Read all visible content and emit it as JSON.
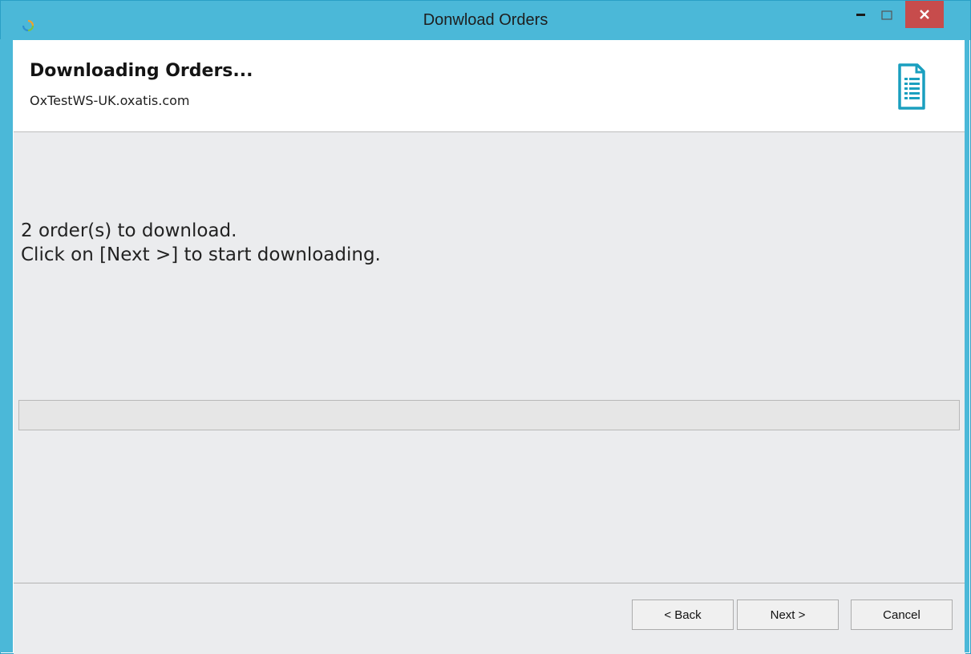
{
  "window": {
    "title": "Donwload Orders",
    "controls": {
      "minimize": "–",
      "maximize": "□",
      "close": "✕"
    }
  },
  "header": {
    "title": "Downloading Orders...",
    "subtitle": "OxTestWS-UK.oxatis.com",
    "icon": "document-icon"
  },
  "content": {
    "message_line1": "2 order(s) to download.",
    "message_line2": "Click on [Next >] to start downloading.",
    "progress": 0
  },
  "footer": {
    "back_label": "< Back",
    "next_label": "Next >",
    "cancel_label": "Cancel"
  },
  "colors": {
    "titlebar": "#4bb8d8",
    "close_button": "#c74c4c",
    "content_bg": "#ebecee",
    "icon_accent": "#1a9fbf"
  }
}
